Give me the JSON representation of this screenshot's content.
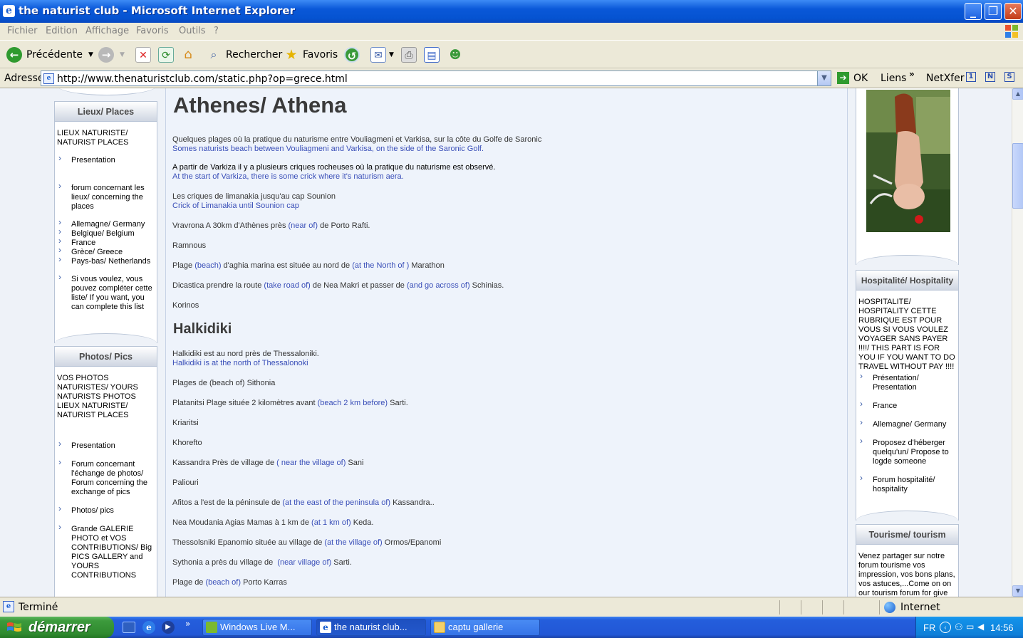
{
  "window": {
    "title": "the naturist club - Microsoft Internet Explorer"
  },
  "menu": [
    "Fichier",
    "Edition",
    "Affichage",
    "Favoris",
    "Outils",
    "?"
  ],
  "toolbar": {
    "back": "Précédente",
    "search": "Rechercher",
    "favorites": "Favoris"
  },
  "address": {
    "label": "Adresse",
    "url": "http://www.thenaturistclub.com/static.php?op=grece.html",
    "go": "OK",
    "links": "Liens",
    "netxfer": "NetXfer",
    "btn1": "1",
    "btnN": "N",
    "btnS": "S"
  },
  "left": {
    "places": {
      "header": "Lieux/ Places",
      "intro": "LIEUX NATURISTE/ NATURIST PLACES",
      "items": [
        "Presentation",
        "forum concernant les lieux/ concerning the places"
      ],
      "countries": [
        "Allemagne/ Germany",
        "Belgique/ Belgium",
        "France",
        "Grèce/ Greece",
        "Pays-bas/ Netherlands"
      ],
      "complete": "Si vous voulez, vous pouvez compléter cette liste/ If you want, you can complete this list"
    },
    "photos": {
      "header": "Photos/ Pics",
      "intro": "VOS PHOTOS NATURISTES/ YOURS NATURISTS PHOTOS LIEUX NATURISTE/ NATURIST PLACES",
      "items": [
        "Presentation",
        "Forum concernant l'échange de photos/ Forum concerning the exchange of pics",
        "Photos/ pics",
        "Grande GALERIE PHOTO et VOS CONTRIBUTIONS/ Big PICS GALLERY and YOURS CONTRIBUTIONS"
      ]
    }
  },
  "content": {
    "title1": "Athenes/ Athena",
    "p1_fr": "Quelques plages où la pratique du naturisme entre Vouliagmeni et Varkisa, sur la côte du Golfe de Saronic",
    "p1_en": "Somes naturists beach between Vouliagmeni and Varkisa, on the side of the Saronic Golf.",
    "p2_fr": "A partir de Varkiza il y a plusieurs criques rocheuses où la pratique du naturisme est observé.",
    "p2_en": "At the start of Varkiza, there is some crick where it's naturism aera.",
    "p3_fr": "Les criques de limanakia jusqu'au cap Sounion",
    "p3_en": "Crick of Limanakia until Sounion cap",
    "p4": {
      "a": "Vravrona A 30km d'Athènes près ",
      "b": "(near of)",
      "c": " de Porto Rafti."
    },
    "p5": "Ramnous",
    "p6": {
      "a": "Plage ",
      "b": "(beach)",
      "c": " d'aghia marina est située au nord de ",
      "d": "(at the North of )",
      "e": " Marathon"
    },
    "p7": {
      "a": "Dicastica prendre la route ",
      "b": "(take road of)",
      "c": " de Nea Makri et passer de ",
      "d": "(and go across of)",
      "e": " Schinias."
    },
    "p8": "Korinos",
    "title2": "Halkidiki",
    "q1_fr": "Halkidiki est au nord près de Thessaloniki.",
    "q1_en": "Halkidiki is at the north of Thessalonoki",
    "q2": "Plages de (beach of) Sithonia",
    "q3": {
      "a": "Platanitsi Plage située 2 kilomètres avant ",
      "b": "(beach 2 km before)",
      "c": " Sarti."
    },
    "q4": "Kriaritsi",
    "q5": "Khorefto",
    "q6": {
      "a": "Kassandra Près de village de ",
      "b": "( near the village of)",
      "c": " Sani"
    },
    "q7": "Paliouri",
    "q8": {
      "a": "Afitos a l'est de la péninsule de ",
      "b": "(at the east of the peninsula of)",
      "c": " Kassandra.."
    },
    "q9": {
      "a": "Nea Moudania Agias Mamas à 1 km de ",
      "b": "(at 1 km of)",
      "c": " Keda."
    },
    "q10": {
      "a": "Thessolsniki Epanomio située au village de ",
      "b": "(at the village of)",
      "c": " Ormos/Epanomi"
    },
    "q11": {
      "a": "Sythonia a près du village de  ",
      "b": "(near village of)",
      "c": " Sarti."
    },
    "q12": {
      "a": "Plage de ",
      "b": "(beach of)",
      "c": " Porto Karras"
    }
  },
  "right": {
    "hospitality": {
      "header": "Hospitalité/ Hospitality",
      "intro": "HOSPITALITE/ HOSPITALITY CETTE RUBRIQUE EST POUR VOUS SI VOUS VOULEZ VOYAGER SANS PAYER !!!!/ THIS PART IS FOR YOU IF YOU WANT TO DO TRAVEL WITHOUT PAY !!!!",
      "items": [
        "Présentation/ Presentation",
        "France",
        "Allemagne/ Germany",
        "Proposez d'héberger quelqu'un/ Propose to logde someone",
        "Forum hospitalité/ hospitality"
      ]
    },
    "tourism": {
      "header": "Tourisme/ tourism",
      "intro": "Venez partager sur notre forum tourisme vos impression, vos bons plans, vos astuces,...Come on on our tourism forum for give"
    }
  },
  "status": {
    "text": "Terminé",
    "zone": "Internet"
  },
  "taskbar": {
    "start": "démarrer",
    "tasks": [
      "Windows Live M...",
      "the naturist club...",
      "captu gallerie"
    ],
    "lang": "FR",
    "time": "14:56"
  }
}
